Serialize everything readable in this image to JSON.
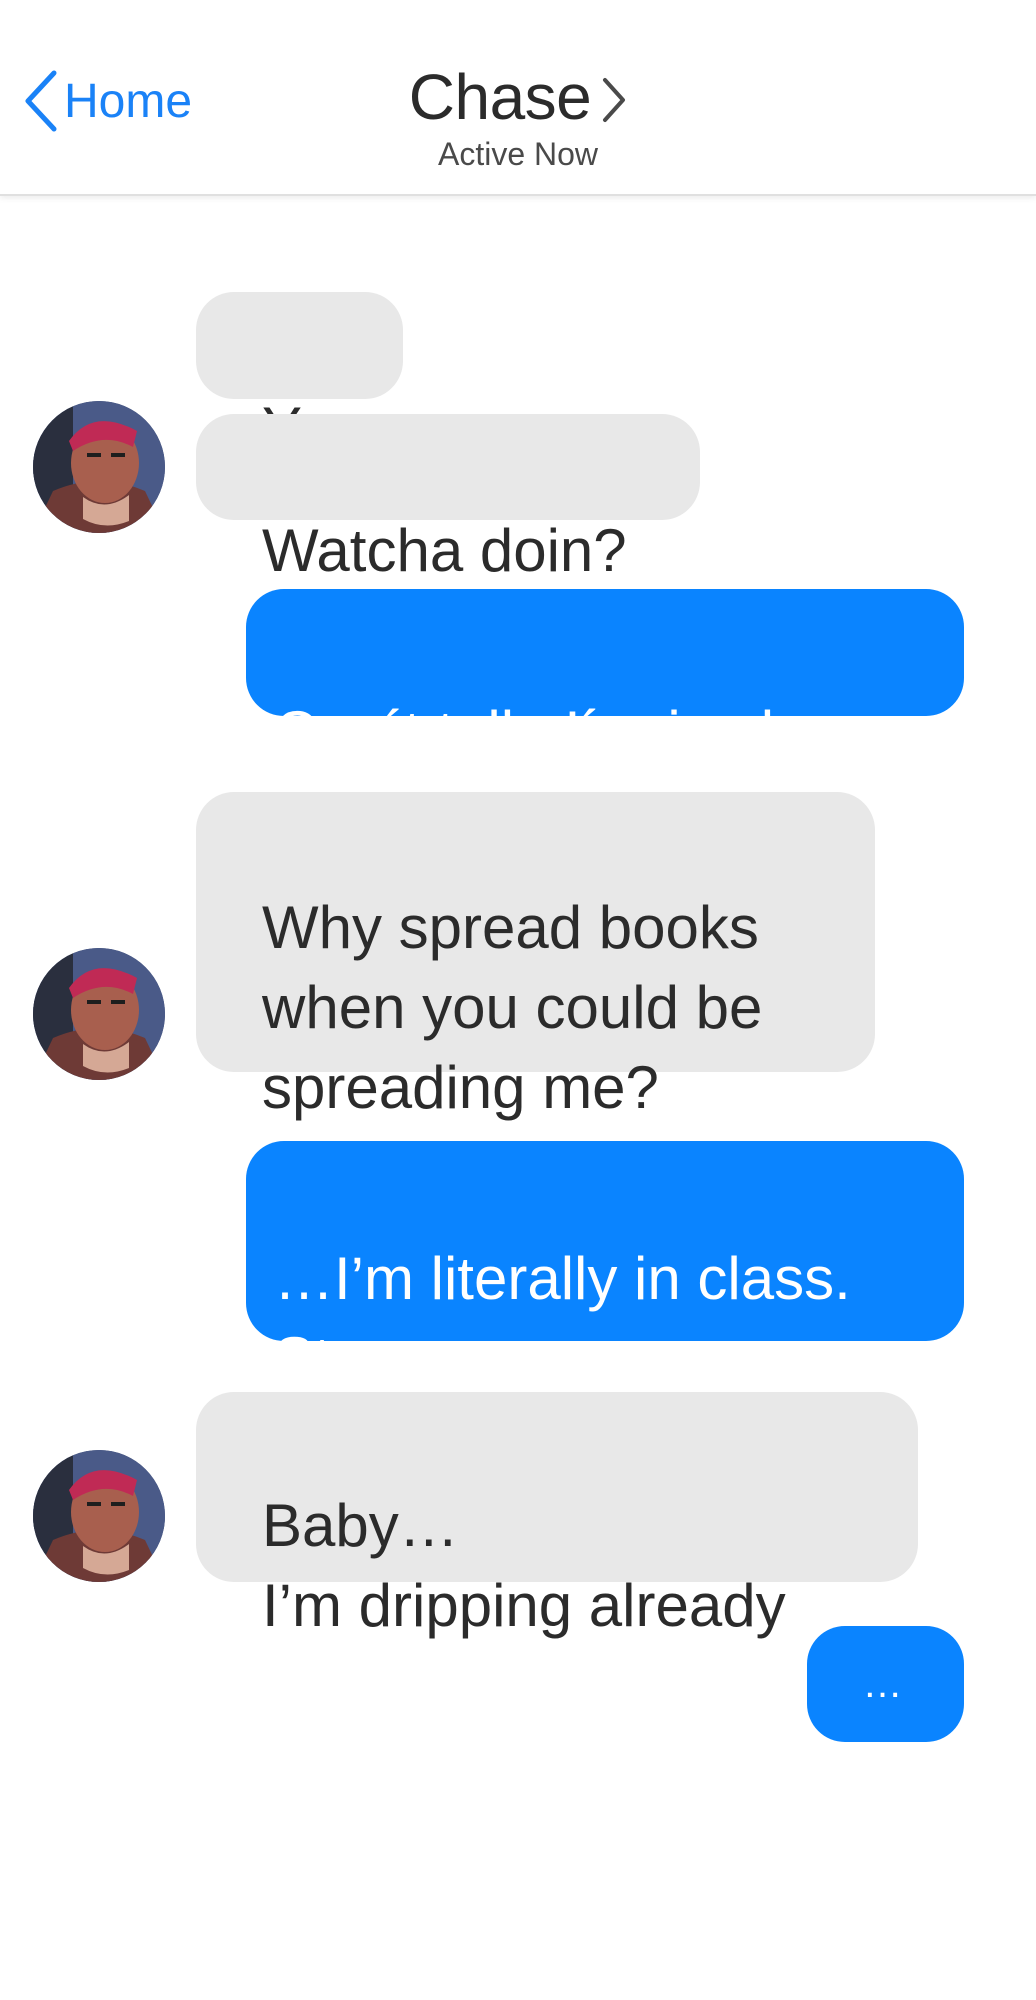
{
  "header": {
    "back_label": "Home",
    "contact_name": "Chase",
    "status": "Active Now"
  },
  "messages": [
    {
      "direction": "incoming",
      "text": "Yo"
    },
    {
      "direction": "incoming",
      "text": "Watcha doin?"
    },
    {
      "direction": "outgoing",
      "text": "Can´t talk, I´m in class"
    },
    {
      "direction": "incoming",
      "text": "Why spread books\nwhen you could be\nspreading me?"
    },
    {
      "direction": "outgoing",
      "text": "…I’m literally in class.\nStop"
    },
    {
      "direction": "incoming",
      "text": "Baby…\nI’m dripping already"
    }
  ],
  "typing_indicator": "…",
  "colors": {
    "accent": "#0a84ff",
    "link": "#1a82f7",
    "incoming_bubble": "#e8e8e8",
    "text": "#2b2b2b"
  },
  "icons": {
    "back": "chevron-left-icon",
    "profile": "chevron-right-icon",
    "avatar": "contact-avatar"
  }
}
